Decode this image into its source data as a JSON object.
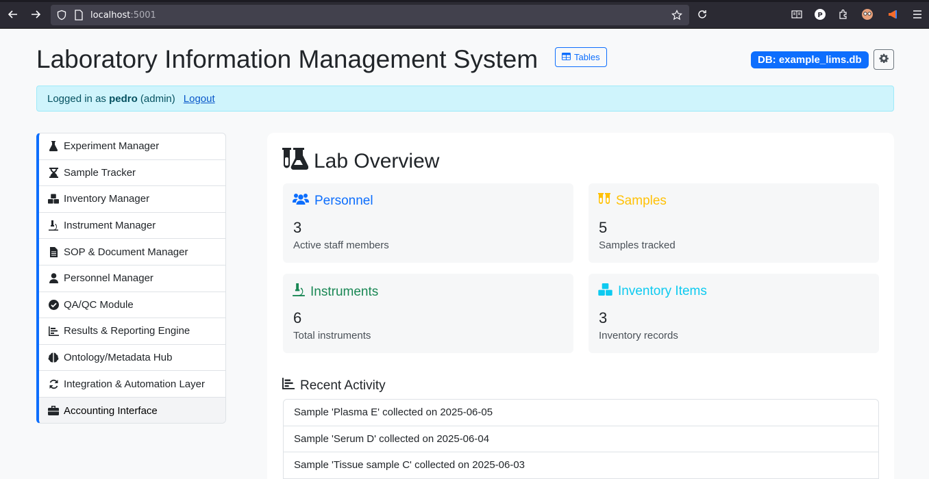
{
  "browser": {
    "url_host": "localhost",
    "url_port": ":5001"
  },
  "header": {
    "title": "Laboratory Information Management System",
    "tables_label": "Tables",
    "db_badge": "DB: example_lims.db"
  },
  "alert": {
    "prefix": "Logged in as",
    "user": "pedro",
    "role": "(admin)",
    "logout": "Logout"
  },
  "sidebar": {
    "items": [
      {
        "label": "Experiment Manager",
        "icon": "flask-icon"
      },
      {
        "label": "Sample Tracker",
        "icon": "hourglass-icon"
      },
      {
        "label": "Inventory Manager",
        "icon": "boxes-icon"
      },
      {
        "label": "Instrument Manager",
        "icon": "microscope-icon"
      },
      {
        "label": "SOP & Document Manager",
        "icon": "document-icon"
      },
      {
        "label": "Personnel Manager",
        "icon": "person-icon"
      },
      {
        "label": "QA/QC Module",
        "icon": "check-circle-icon"
      },
      {
        "label": "Results & Reporting Engine",
        "icon": "chart-icon"
      },
      {
        "label": "Ontology/Metadata Hub",
        "icon": "brain-icon"
      },
      {
        "label": "Integration & Automation Layer",
        "icon": "sync-icon"
      },
      {
        "label": "Accounting Interface",
        "icon": "briefcase-icon"
      }
    ]
  },
  "overview": {
    "title": "Lab Overview",
    "stats": [
      {
        "title": "Personnel",
        "value": "3",
        "desc": "Active staff members",
        "color": "#0d6efd"
      },
      {
        "title": "Samples",
        "value": "5",
        "desc": "Samples tracked",
        "color": "#ffc107"
      },
      {
        "title": "Instruments",
        "value": "6",
        "desc": "Total instruments",
        "color": "#198754"
      },
      {
        "title": "Inventory Items",
        "value": "3",
        "desc": "Inventory records",
        "color": "#0dcaf0"
      }
    ]
  },
  "recent": {
    "title": "Recent Activity",
    "items": [
      "Sample 'Plasma E' collected on 2025-06-05",
      "Sample 'Serum D' collected on 2025-06-04",
      "Sample 'Tissue sample C' collected on 2025-06-03"
    ]
  }
}
